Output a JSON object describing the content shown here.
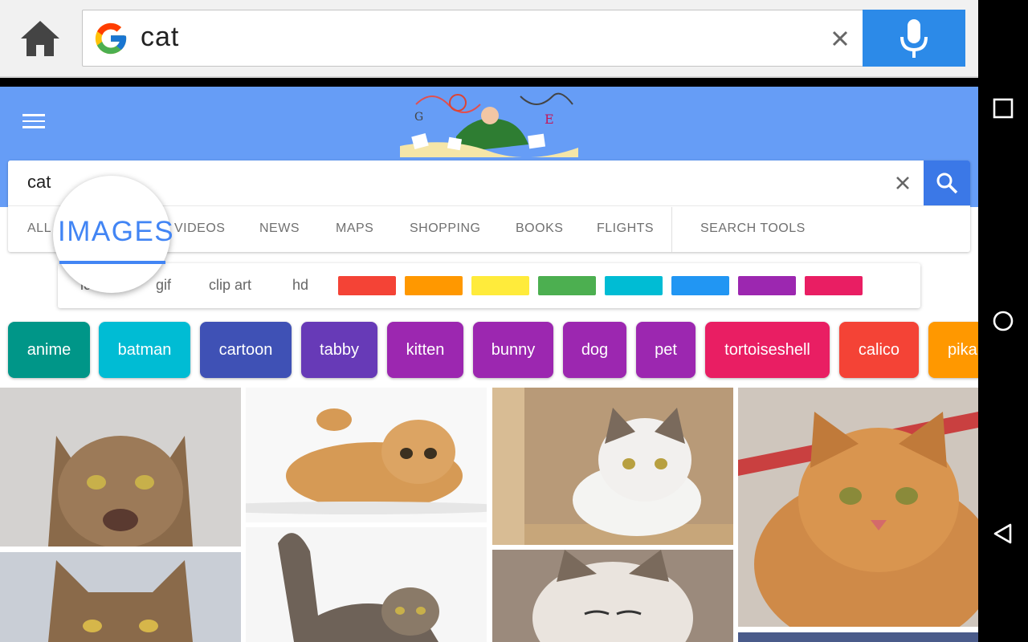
{
  "browser": {
    "query": "cat",
    "icons": {
      "home": "home-icon",
      "clear": "close-icon",
      "mic": "microphone-icon",
      "google": "google-g-icon"
    }
  },
  "search": {
    "query": "cat",
    "tabs": [
      "ALL",
      "IMAGES",
      "VIDEOS",
      "NEWS",
      "MAPS",
      "SHOPPING",
      "BOOKS",
      "FLIGHTS",
      "SEARCH TOOLS"
    ],
    "active_tab": "IMAGES",
    "accent": "#4285f4"
  },
  "filters": {
    "partial_text": "ic",
    "labels": [
      "gif",
      "clip art",
      "hd"
    ],
    "colors": [
      "#f44336",
      "#ff9800",
      "#ffeb3b",
      "#4caf50",
      "#00bcd4",
      "#2196f3",
      "#9c27b0",
      "#e91e63"
    ]
  },
  "related": [
    {
      "label": "anime",
      "color": "#009688"
    },
    {
      "label": "batman",
      "color": "#00bcd4"
    },
    {
      "label": "cartoon",
      "color": "#3f51b5"
    },
    {
      "label": "tabby",
      "color": "#673ab7"
    },
    {
      "label": "kitten",
      "color": "#9c27b0"
    },
    {
      "label": "bunny",
      "color": "#9c27b0"
    },
    {
      "label": "dog",
      "color": "#9c27b0"
    },
    {
      "label": "pet",
      "color": "#9c27b0"
    },
    {
      "label": "tortoiseshell",
      "color": "#e91e63"
    },
    {
      "label": "calico",
      "color": "#f44336"
    },
    {
      "label": "pika",
      "color": "#ff9800"
    }
  ],
  "nav": {
    "icons": [
      "recents-icon",
      "home-circle-icon",
      "back-icon"
    ]
  }
}
